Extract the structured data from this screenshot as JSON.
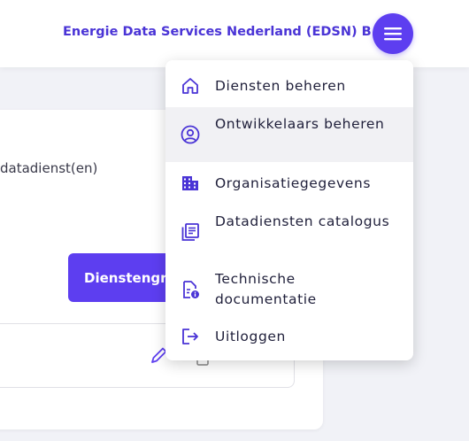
{
  "header": {
    "organization": "Energie Data Services Nederland (EDSN) B.V.",
    "menu_icon": "hamburger-icon"
  },
  "card": {
    "text": "datadienst(en)",
    "button_label": "Dienstengroep"
  },
  "menu": {
    "items": [
      {
        "label": "Diensten beheren",
        "icon": "home-icon"
      },
      {
        "label": "Ontwikkelaars beheren",
        "icon": "user-circle-icon"
      },
      {
        "label": "Organisatiegegevens",
        "icon": "building-icon"
      },
      {
        "label": "Datadiensten catalogus",
        "icon": "catalog-icon"
      },
      {
        "label": "Technische documentatie",
        "icon": "document-info-icon"
      },
      {
        "label": "Uitloggen",
        "icon": "logout-icon"
      }
    ]
  },
  "colors": {
    "accent": "#5d3ef0",
    "brand_text": "#4a34d6",
    "background": "#f1f2f7"
  }
}
